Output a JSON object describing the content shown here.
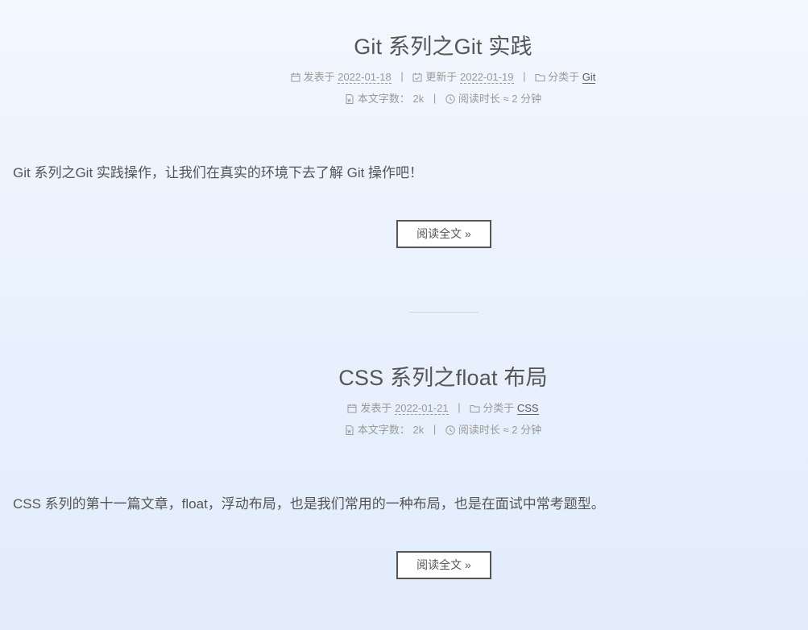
{
  "posts": [
    {
      "title": "Git 系列之Git 实践",
      "meta_line1": {
        "published_label": "发表于",
        "published_date": "2022-01-18",
        "updated_label": "更新于",
        "updated_date": "2022-01-19",
        "category_label": "分类于",
        "category": "Git"
      },
      "meta_line2": {
        "wordcount_label": "本文字数：",
        "wordcount": "2k",
        "readtime_label": "阅读时长 ≈",
        "readtime": "2 分钟"
      },
      "excerpt": "Git 系列之Git 实践操作，让我们在真实的环境下去了解 Git 操作吧！",
      "read_more": "阅读全文 »"
    },
    {
      "title": "CSS 系列之float 布局",
      "meta_line1": {
        "published_label": "发表于",
        "published_date": "2022-01-21",
        "category_label": "分类于",
        "category": "CSS"
      },
      "meta_line2": {
        "wordcount_label": "本文字数：",
        "wordcount": "2k",
        "readtime_label": "阅读时长 ≈",
        "readtime": "2 分钟"
      },
      "excerpt": "CSS 系列的第十一篇文章，float，浮动布局，也是我们常用的一种布局，也是在面试中常考题型。",
      "read_more": "阅读全文 »"
    }
  ],
  "separator": "|",
  "icons": {
    "published": "calendar-icon",
    "updated": "calendar-check-icon",
    "category": "folder-icon",
    "wordcount": "file-word-icon",
    "readtime": "clock-icon"
  },
  "colors": {
    "text": "#555555",
    "meta": "#999999",
    "background": "#e9f1fd"
  }
}
